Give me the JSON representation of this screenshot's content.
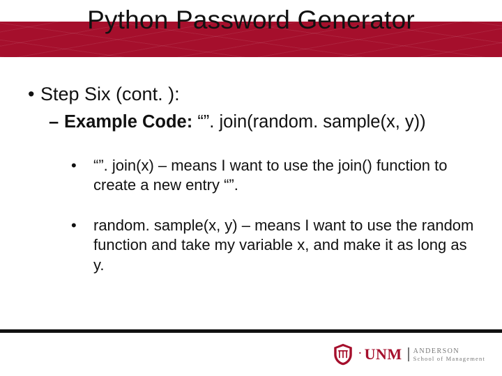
{
  "colors": {
    "brand": "#a50f2c",
    "text": "#111111",
    "rule": "#111111",
    "muted": "#777777"
  },
  "header": {
    "title": "Python Password Generator"
  },
  "content": {
    "step_heading": "Step Six (cont. ):",
    "example_code_label": "Example Code: ",
    "example_code": "“”. join(random. sample(x, y))",
    "bullets": {
      "b1": "“”. join(x) – means I want to use the join() function to create a new entry “”.",
      "b2": "random. sample(x, y) – means I want to use the random function and take my variable x, and make it as long as y."
    }
  },
  "footer": {
    "org": "UNM",
    "dot": ".",
    "line1": "ANDERSON",
    "line2": "School of Management"
  }
}
